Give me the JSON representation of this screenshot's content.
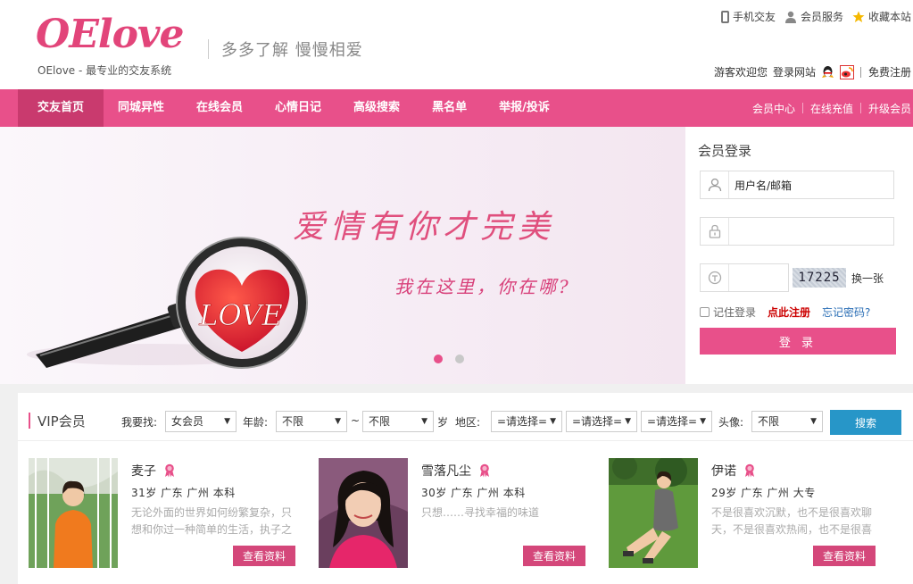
{
  "header": {
    "logo_text": "OElove",
    "logo_tagline": "OElove - 最专业的交友系统",
    "slogan": "多多了解  慢慢相爱",
    "top_links": [
      "手机交友",
      "会员服务",
      "收藏本站"
    ],
    "welcome": "游客欢迎您",
    "login_link": "登录网站",
    "register_link": "免费注册"
  },
  "nav": {
    "items": [
      "交友首页",
      "同城异性",
      "在线会员",
      "心情日记",
      "高级搜索",
      "黑名单",
      "举报/投诉"
    ],
    "right_links": [
      "会员中心",
      "在线充值",
      "升级会员"
    ]
  },
  "banner": {
    "title": "爱情有你才完美",
    "subtitle": "我在这里，你在哪?",
    "heart_text": "LOVE"
  },
  "login": {
    "title": "会员登录",
    "username_value": "用户名/邮箱",
    "captcha": "17225",
    "change_code": "换一张",
    "remember": "记住登录",
    "register": "点此注册",
    "forgot": "忘记密码?",
    "submit": "登 录"
  },
  "vip": {
    "title": "VIP会员",
    "filters": {
      "seek_label": "我要找:",
      "seek_value": "女会员",
      "age_label": "年龄:",
      "age_from": "不限",
      "tilde": "~",
      "age_to": "不限",
      "age_unit": "岁",
      "area_label": "地区:",
      "area_values": [
        "=请选择=",
        "=请选择=",
        "=请选择="
      ],
      "avatar_label": "头像:",
      "avatar_value": "不限",
      "search": "搜索"
    },
    "members": [
      {
        "name": "麦子",
        "info": "31岁 广东 广州 本科",
        "desc": "无论外面的世界如何纷繁复杂，只想和你过一种简单的生活，执子之",
        "button": "查看资料"
      },
      {
        "name": "雪落凡尘",
        "info": "30岁 广东 广州 本科",
        "desc": "只想……寻找幸福的味道",
        "button": "查看资料"
      },
      {
        "name": "伊诺",
        "info": "29岁 广东 广州 大专",
        "desc": "不是很喜欢沉默，也不是很喜欢聊天，不是很喜欢热闹，也不是很喜",
        "button": "查看资料"
      }
    ]
  },
  "colors": {
    "brand_pink": "#e8508a",
    "nav_active": "#c93a6e",
    "search_blue": "#2796c8"
  }
}
